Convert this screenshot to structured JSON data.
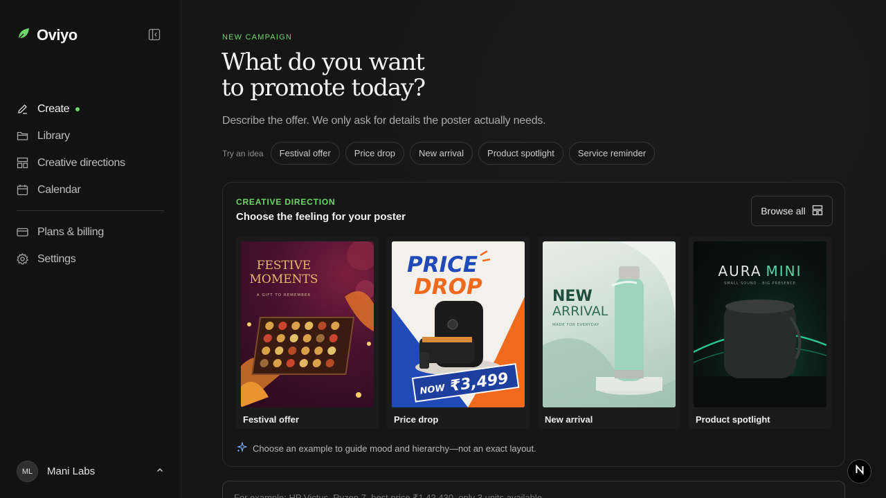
{
  "brand": {
    "name": "Oviyo"
  },
  "nav": {
    "items": [
      {
        "label": "Create",
        "icon": "pencil-icon",
        "active": true
      },
      {
        "label": "Library",
        "icon": "folder-icon"
      },
      {
        "label": "Creative directions",
        "icon": "layout-icon"
      },
      {
        "label": "Calendar",
        "icon": "calendar-icon"
      }
    ],
    "secondary": [
      {
        "label": "Plans & billing",
        "icon": "credit-card-icon"
      },
      {
        "label": "Settings",
        "icon": "gear-icon"
      }
    ]
  },
  "user": {
    "initials": "ML",
    "name": "Mani Labs"
  },
  "header": {
    "eyebrow": "NEW CAMPAIGN",
    "title_line1": "What do you want",
    "title_line2": "to promote today?",
    "subtitle": "Describe the offer. We only ask for details the poster actually needs."
  },
  "ideas": {
    "label": "Try an idea",
    "chips": [
      "Festival offer",
      "Price drop",
      "New arrival",
      "Product spotlight",
      "Service reminder"
    ]
  },
  "direction": {
    "eyebrow": "CREATIVE DIRECTION",
    "title": "Choose the feeling for your poster",
    "browse_label": "Browse all",
    "cards": [
      {
        "label": "Festival offer",
        "poster_title_1": "FESTIVE",
        "poster_title_2": "MOMENTS",
        "poster_sub": "A GIFT TO REMEMBER"
      },
      {
        "label": "Price drop",
        "poster_title_1": "PRICE",
        "poster_title_2": "DROP",
        "poster_now": "NOW",
        "poster_price": "₹3,499"
      },
      {
        "label": "New arrival",
        "poster_title_1": "NEW",
        "poster_title_2": "ARRIVAL",
        "poster_sub": "MADE FOR EVERYDAY"
      },
      {
        "label": "Product spotlight",
        "poster_title_1": "AURA",
        "poster_title_2": "MINI",
        "poster_sub": "SMALL SOUND · BIG PRESENCE"
      }
    ],
    "hint": "Choose an example to guide mood and hierarchy—not an exact layout."
  },
  "prompt": {
    "placeholder": "For example: HP Victus, Ryzen 7, best price ₹1,42,430, only 3 units available"
  },
  "colors": {
    "accent": "#6fd66a",
    "background": "#151515",
    "sidebar": "#121212"
  }
}
